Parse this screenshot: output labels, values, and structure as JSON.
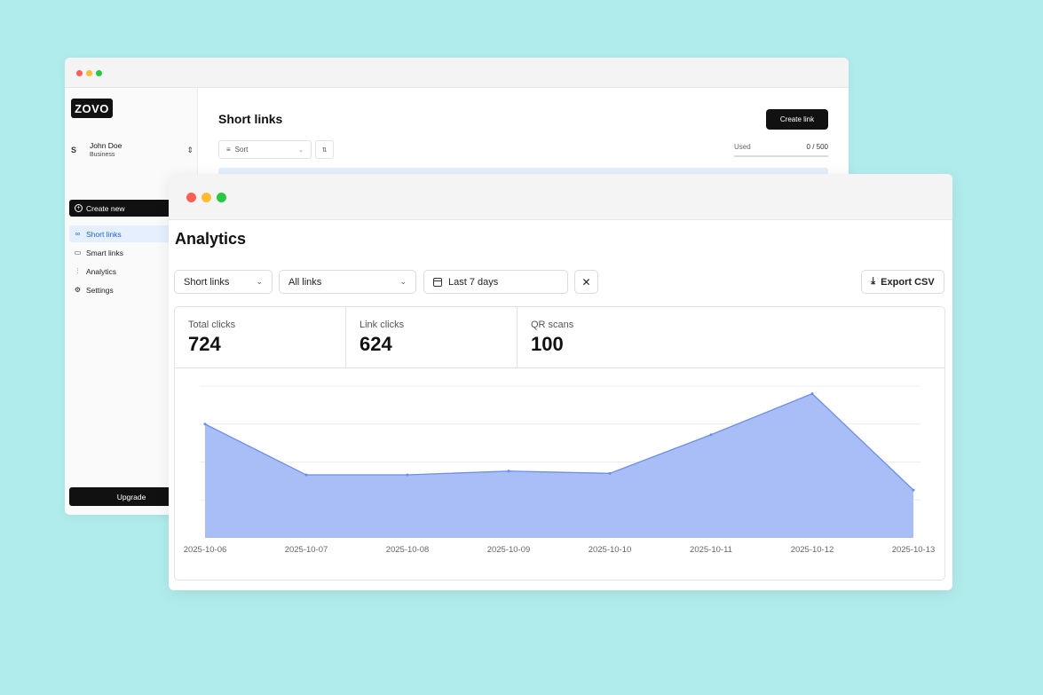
{
  "back_window": {
    "logo": "ZOVO",
    "user": {
      "initial": "S",
      "name": "John Doe",
      "plan": "Business"
    },
    "create_new_label": "Create new",
    "nav": [
      {
        "label": "Short links",
        "icon": "link-icon",
        "active": true
      },
      {
        "label": "Smart links",
        "icon": "smart-link-icon",
        "active": false
      },
      {
        "label": "Analytics",
        "icon": "analytics-icon",
        "active": false
      },
      {
        "label": "Settings",
        "icon": "gear-icon",
        "active": false
      }
    ],
    "upgrade_label": "Upgrade",
    "title": "Short links",
    "create_link_label": "Create link",
    "sort_label": "Sort",
    "used_label": "Used",
    "used_value": "0 / 500"
  },
  "front_window": {
    "title": "Analytics",
    "filters": {
      "type": "Short links",
      "links": "All links",
      "range": "Last 7 days"
    },
    "clear_label": "✕",
    "export_label": "Export CSV",
    "stats": [
      {
        "label": "Total clicks",
        "value": "724"
      },
      {
        "label": "Link clicks",
        "value": "624"
      },
      {
        "label": "QR scans",
        "value": "100"
      }
    ]
  },
  "colors": {
    "background": "#b1ecec",
    "accent": "#1f63d8",
    "area_fill": "#a4bbf6",
    "area_line": "#6c8ee8"
  },
  "chart_data": {
    "type": "area",
    "x": [
      "2025-10-06",
      "2025-10-07",
      "2025-10-08",
      "2025-10-09",
      "2025-10-10",
      "2025-10-11",
      "2025-10-12",
      "2025-10-13"
    ],
    "values": [
      150,
      83,
      83,
      88,
      85,
      136,
      190,
      63
    ],
    "ylim": [
      0,
      200
    ],
    "grid": true
  }
}
